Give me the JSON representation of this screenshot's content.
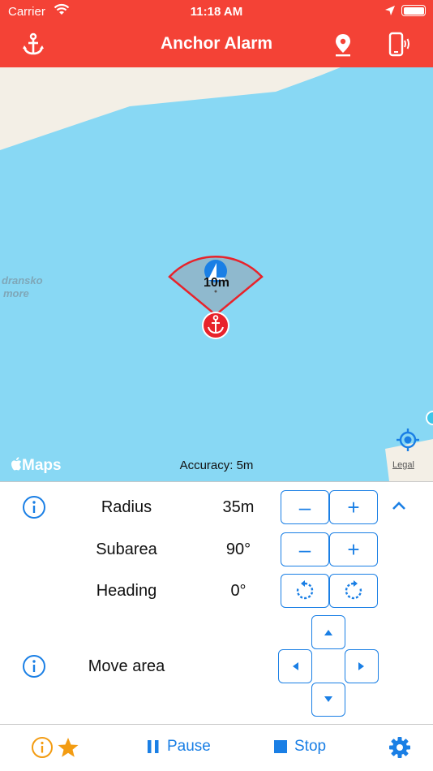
{
  "status_bar": {
    "carrier": "Carrier",
    "time": "11:18 AM"
  },
  "navbar": {
    "title": "Anchor Alarm",
    "left_icon": "anchor-icon",
    "right_icons": [
      "map-pin-icon",
      "phone-vibrate-icon"
    ]
  },
  "map": {
    "place_name_line1": "dransko",
    "place_name_line2": "more",
    "sector_label": "10m",
    "maps_logo": "Maps",
    "accuracy": "Accuracy: 5m",
    "legal": "Legal",
    "water_color": "#88d8f4",
    "land_color": "#f3efe6",
    "sector_stroke": "#e8232b"
  },
  "controls": {
    "radius": {
      "label": "Radius",
      "value": "35m"
    },
    "subarea": {
      "label": "Subarea",
      "value": "90°"
    },
    "heading": {
      "label": "Heading",
      "value": "0°"
    },
    "move_area": {
      "label": "Move area"
    },
    "minus_label": "–",
    "plus_label": "+"
  },
  "tabbar": {
    "pause_label": "Pause",
    "stop_label": "Stop"
  },
  "colors": {
    "accent": "#1a7fe5",
    "header": "#f44236",
    "star": "#f39c12"
  }
}
